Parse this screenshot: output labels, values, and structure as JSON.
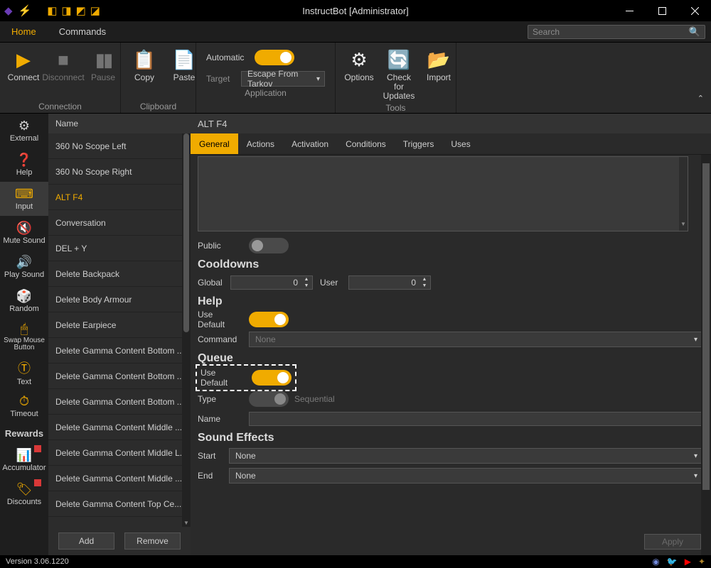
{
  "window": {
    "title": "InstructBot [Administrator]"
  },
  "menubar": {
    "tabs": [
      "Home",
      "Commands"
    ],
    "active": 0,
    "search_placeholder": "Search"
  },
  "ribbon": {
    "connection": {
      "label": "Connection",
      "connect": "Connect",
      "disconnect": "Disconnect",
      "pause": "Pause"
    },
    "clipboard": {
      "label": "Clipboard",
      "copy": "Copy",
      "paste": "Paste"
    },
    "application": {
      "label": "Application",
      "automatic": "Automatic",
      "auto_on": true,
      "target_label": "Target",
      "target_value": "Escape From Tarkov"
    },
    "tools": {
      "label": "Tools",
      "options": "Options",
      "updates": "Check for Updates",
      "import": "Import"
    }
  },
  "rail": {
    "items": [
      {
        "label": "External",
        "icon": "⚙"
      },
      {
        "label": "Help",
        "icon": "❓"
      },
      {
        "label": "Input",
        "icon": "🖱"
      },
      {
        "label": "Mute Sound",
        "icon": "🔇"
      },
      {
        "label": "Play Sound",
        "icon": "🔊"
      },
      {
        "label": "Random",
        "icon": "🎲"
      },
      {
        "label": "Swap Mouse Button",
        "icon": "🖱"
      },
      {
        "label": "Text",
        "icon": "Ⓣ"
      },
      {
        "label": "Timeout",
        "icon": "⏱"
      },
      {
        "label": "Rewards",
        "icon": ""
      },
      {
        "label": "Accumulator",
        "icon": "📊"
      },
      {
        "label": "Discounts",
        "icon": "🏷"
      }
    ],
    "selected": 2
  },
  "commands": {
    "header": "Name",
    "items": [
      "360 No Scope Left",
      "360 No Scope Right",
      "ALT F4",
      "Conversation",
      "DEL + Y",
      "Delete Backpack",
      "Delete Body Armour",
      "Delete Earpiece",
      "Delete Gamma Content Bottom ...",
      "Delete Gamma Content Bottom ...",
      "Delete Gamma Content Bottom ...",
      "Delete Gamma Content Middle ...",
      "Delete Gamma Content Middle L...",
      "Delete Gamma Content Middle ...",
      "Delete Gamma Content Top Ce..."
    ],
    "selected": 2,
    "add": "Add",
    "remove": "Remove"
  },
  "detail": {
    "title": "ALT F4",
    "tabs": [
      "General",
      "Actions",
      "Activation",
      "Conditions",
      "Triggers",
      "Uses"
    ],
    "active_tab": 0,
    "public_label": "Public",
    "public_on": false,
    "cooldowns": {
      "header": "Cooldowns",
      "global_label": "Global",
      "global_value": "0",
      "user_label": "User",
      "user_value": "0"
    },
    "help": {
      "header": "Help",
      "use_default_label": "Use Default",
      "use_default_on": true,
      "command_label": "Command",
      "command_value": "None"
    },
    "queue": {
      "header": "Queue",
      "use_default_label": "Use Default",
      "use_default_on": true,
      "type_label": "Type",
      "type_value": "Sequential",
      "name_label": "Name"
    },
    "sound": {
      "header": "Sound Effects",
      "start_label": "Start",
      "start_value": "None",
      "end_label": "End",
      "end_value": "None"
    },
    "apply": "Apply"
  },
  "footer": {
    "version": "Version 3.06.1220"
  }
}
